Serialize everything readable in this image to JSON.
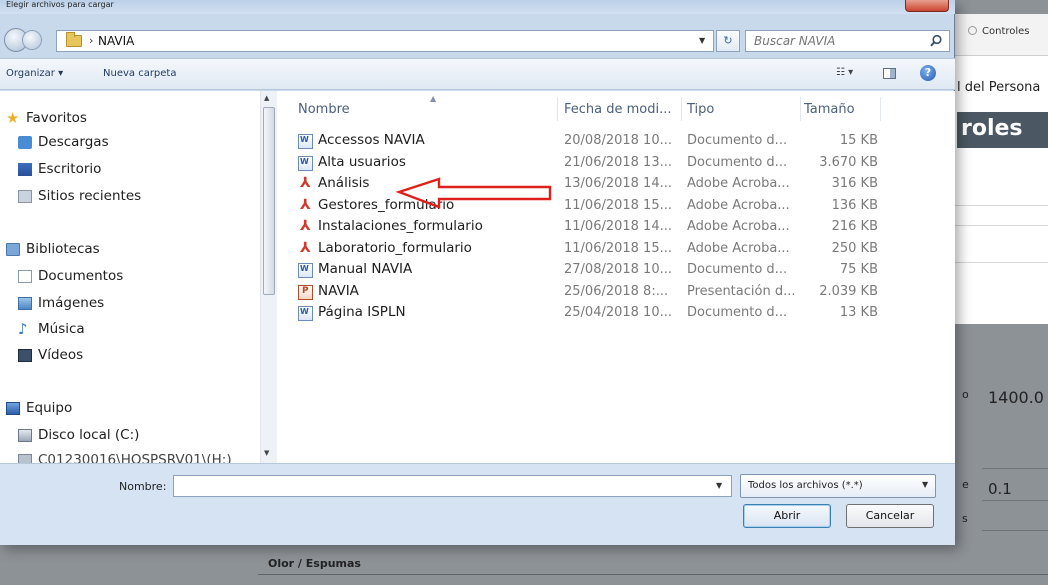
{
  "dialog": {
    "title": "Elegir archivos para cargar",
    "path": "NAVIA",
    "search_placeholder": "Buscar NAVIA"
  },
  "toolbar": {
    "organize_label": "Organizar ▾",
    "new_folder_label": "Nueva carpeta",
    "view_label": "☷ ▾"
  },
  "nav": {
    "favorites": "Favoritos",
    "downloads": "Descargas",
    "desktop": "Escritorio",
    "recent": "Sitios recientes",
    "libraries": "Bibliotecas",
    "documents": "Documentos",
    "images": "Imágenes",
    "music": "Música",
    "videos": "Vídeos",
    "computer": "Equipo",
    "local_disk": "Disco local (C:)",
    "network_drive": "C01230016\\HOSPSRV01\\(H:)"
  },
  "columns": {
    "name": "Nombre",
    "date": "Fecha de modi...",
    "type": "Tipo",
    "size": "Tamaño"
  },
  "files": [
    {
      "name": "Accessos NAVIA",
      "date": "20/08/2018 10...",
      "type": "Documento d...",
      "size": "15 KB",
      "icon": "word"
    },
    {
      "name": "Alta usuarios",
      "date": "21/06/2018 13...",
      "type": "Documento d...",
      "size": "3.670 KB",
      "icon": "word"
    },
    {
      "name": "Análisis",
      "date": "13/06/2018 14...",
      "type": "Adobe Acroba...",
      "size": "316 KB",
      "icon": "pdf"
    },
    {
      "name": "Gestores_formulario",
      "date": "11/06/2018 15...",
      "type": "Adobe Acroba...",
      "size": "136 KB",
      "icon": "pdf"
    },
    {
      "name": "Instalaciones_formulario",
      "date": "11/06/2018 14...",
      "type": "Adobe Acroba...",
      "size": "216 KB",
      "icon": "pdf"
    },
    {
      "name": "Laboratorio_formulario",
      "date": "11/06/2018 15...",
      "type": "Adobe Acroba...",
      "size": "250 KB",
      "icon": "pdf"
    },
    {
      "name": "Manual NAVIA",
      "date": "27/08/2018 10...",
      "type": "Documento d...",
      "size": "75 KB",
      "icon": "word"
    },
    {
      "name": "NAVIA",
      "date": "25/06/2018 8:...",
      "type": "Presentación d...",
      "size": "2.039 KB",
      "icon": "ppt"
    },
    {
      "name": "Página ISPLN",
      "date": "25/04/2018 10...",
      "type": "Documento d...",
      "size": "13 KB",
      "icon": "word"
    }
  ],
  "bottom": {
    "filename_label": "Nombre:",
    "filename_value": "",
    "filter_value": "Todos los archivos (*.*)",
    "open_label": "Abrir",
    "cancel_label": "Cancelar"
  },
  "background_page": {
    "tab_label": "Controles",
    "heading_fragment": "l del Persona",
    "section_fragment": "roles",
    "value1": "1400.0",
    "value2": "0.1",
    "fragment1": "o",
    "fragment2": "e",
    "fragment3": "s",
    "bottom_label": "Olor / Espumas"
  }
}
